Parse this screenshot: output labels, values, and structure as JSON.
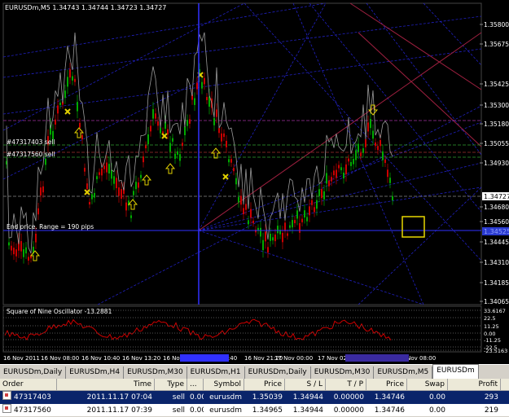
{
  "chart": {
    "title": "EURUSDm,M5  1.34743 1.34744 1.34723 1.34727",
    "price_labels": [
      "1.35800",
      "1.35675",
      "1.35425",
      "1.35300",
      "1.35180",
      "1.35055",
      "1.34930",
      "1.34727",
      "1.34680",
      "1.34560",
      "1.34445",
      "1.34310",
      "1.34185",
      "1.34065"
    ],
    "current_price": "1.34727",
    "blue_price_tag": "1.34525",
    "order_labels": [
      "#47317403 sell",
      "#47317560 sell"
    ],
    "end_price_text": "End price. Range = 190 pips",
    "oscillator_title": "Square of Nine Oscillator -13.2881",
    "oscillator_levels": [
      "33.6167",
      "22.5",
      "11.25",
      "0.00",
      "-11.25",
      "-22.5",
      "-23.5163"
    ],
    "time_labels": [
      "16 Nov 2011",
      "16 Nov 08:00",
      "16 Nov 10:40",
      "16 Nov 13:20",
      "16 Nov 16:00",
      "16 Nov 18:40",
      "16 Nov 21:20",
      "17 Nov 00:00",
      "17 Nov 02:40",
      "17 Nov 05:20",
      "17 Nov 08:00"
    ],
    "colors": {
      "background": "#000000",
      "price_line": "#b8b8b8",
      "grid_line": "#1f2a8a",
      "up_candle": "#00aa00",
      "down_candle": "#cc0000",
      "arrow": "#e0d000",
      "oscillator": "#cc0000",
      "fan_red": "#a02040",
      "fan_blue": "#2020c0"
    }
  },
  "tabs": [
    "EURUSDm,Daily",
    "EURUSDm,H4",
    "EURUSDm,M30",
    "EURUSDm,H1",
    "EURUSDm,Daily",
    "EURUSDm,M30",
    "EURUSDm,M5",
    "EURUSDm"
  ],
  "active_tab_index": 7,
  "orders": {
    "headers": [
      "Order",
      "Time",
      "Type",
      "...",
      "Symbol",
      "Price",
      "S / L",
      "T / P",
      "Price",
      "Swap",
      "Profit"
    ],
    "rows": [
      {
        "order": "47317403",
        "time": "2011.11.17 07:04",
        "type": "sell",
        "size": "0.00",
        "symbol": "eurusdm",
        "open_price": "1.35039",
        "sl": "1.34944",
        "tp": "0.00000",
        "price": "1.34746",
        "swap": "0.00",
        "profit": "293"
      },
      {
        "order": "47317560",
        "time": "2011.11.17 07:39",
        "type": "sell",
        "size": "0.00",
        "symbol": "eurusdm",
        "open_price": "1.34965",
        "sl": "1.34944",
        "tp": "0.00000",
        "price": "1.34746",
        "swap": "0.00",
        "profit": "219"
      }
    ]
  }
}
